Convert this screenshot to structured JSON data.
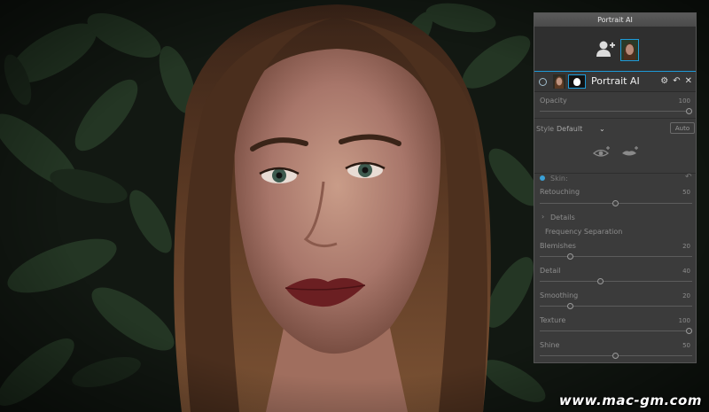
{
  "panel": {
    "title": "Portrait AI",
    "layer_name": "Portrait AI",
    "opacity": {
      "label": "Opacity",
      "value": "100"
    },
    "style": {
      "label": "Style",
      "value": "Default",
      "auto_label": "Auto"
    },
    "skin_section": "Skin:",
    "retouching": {
      "label": "Retouching",
      "value": "50"
    },
    "details_label": "Details",
    "frequency_label": "Frequency Separation",
    "sliders": [
      {
        "label": "Blemishes",
        "value": "20"
      },
      {
        "label": "Detail",
        "value": "40"
      },
      {
        "label": "Smoothing",
        "value": "20"
      },
      {
        "label": "Texture",
        "value": "100"
      },
      {
        "label": "Shine",
        "value": "50"
      }
    ]
  },
  "icons": {
    "add_person": "add-person-icon",
    "settings": "gear-icon",
    "reset": "undo-icon",
    "close": "close-icon",
    "eye": "eye-icon",
    "lips": "lips-icon",
    "chevron": "chevron-down-icon",
    "expand": "chevron-right-icon"
  },
  "watermark": "www.mac-gm.com",
  "colors": {
    "accent": "#1d9bd9",
    "panel_bg": "#3b3b3b"
  }
}
